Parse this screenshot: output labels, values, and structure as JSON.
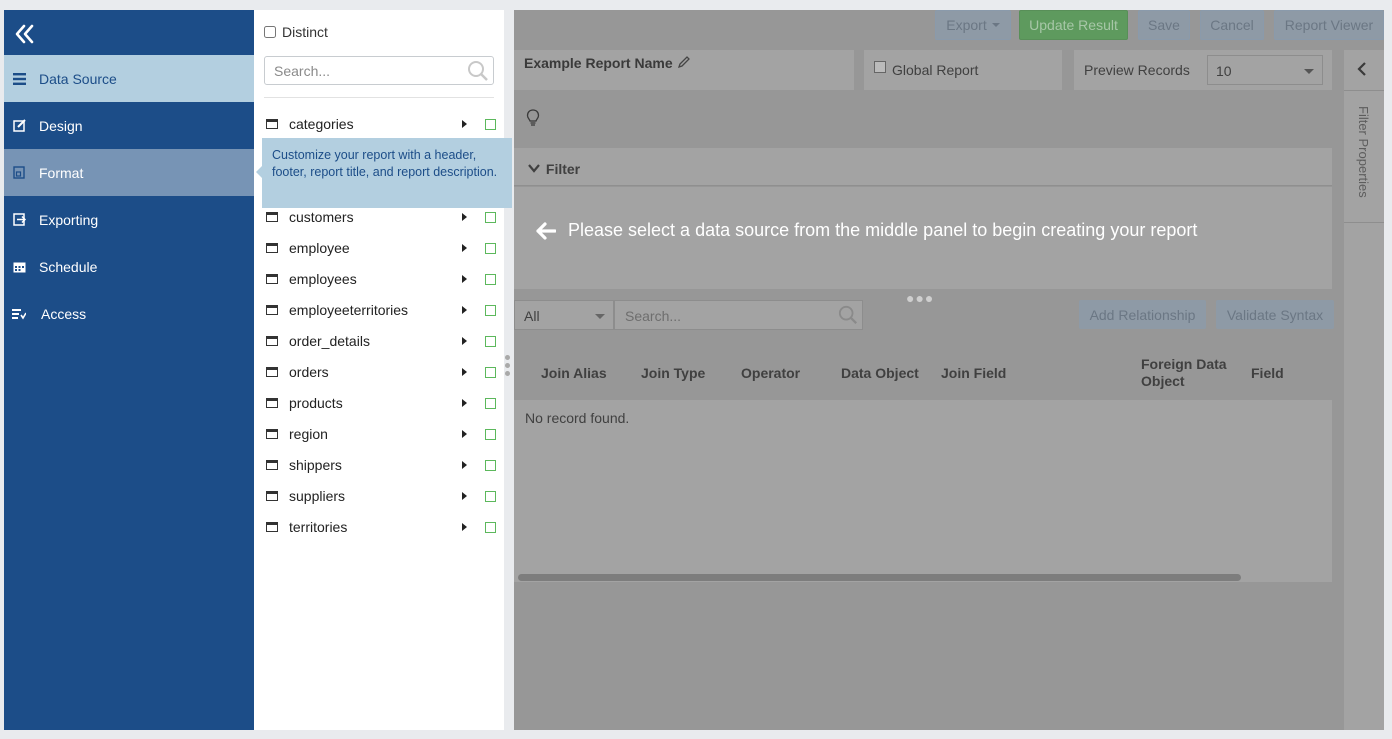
{
  "nav": {
    "items": [
      {
        "label": "Data Source",
        "icon": "list-icon"
      },
      {
        "label": "Design",
        "icon": "edit-icon"
      },
      {
        "label": "Format",
        "icon": "format-icon"
      },
      {
        "label": "Exporting",
        "icon": "export-icon"
      },
      {
        "label": "Schedule",
        "icon": "calendar-icon"
      },
      {
        "label": "Access",
        "icon": "access-icon"
      }
    ],
    "active_item": "Data Source",
    "hover_item": "Format"
  },
  "datasource": {
    "distinct_label": "Distinct",
    "search_placeholder": "Search...",
    "tables": [
      "categories",
      "customers",
      "employee",
      "employees",
      "employeeterritories",
      "order_details",
      "orders",
      "products",
      "region",
      "shippers",
      "suppliers",
      "territories"
    ]
  },
  "tooltip": {
    "text": "Customize your report with a header, footer, report title, and report description."
  },
  "toolbar": {
    "export_label": "Export",
    "update_label": "Update Result",
    "save_label": "Save",
    "cancel_label": "Cancel",
    "viewer_label": "Report Viewer"
  },
  "report": {
    "name": "Example Report Name",
    "global_label": "Global Report",
    "preview_label": "Preview Records",
    "preview_value": "10"
  },
  "filter": {
    "header": "Filter",
    "message": "Please select a data source from the middle panel to begin creating your report"
  },
  "relationships": {
    "filter_value": "All",
    "search_placeholder": "Search...",
    "add_label": "Add Relationship",
    "validate_label": "Validate Syntax",
    "columns": [
      "Join Alias",
      "Join Type",
      "Operator",
      "Data Object",
      "Join Field",
      "Foreign Data Object",
      "Field"
    ],
    "empty_text": "No record found."
  },
  "filter_properties": {
    "label": "Filter Properties"
  },
  "colors": {
    "nav_bg": "#1c4d88",
    "nav_active": "#b3cfe0",
    "nav_hover": "#7794b5",
    "overlay": "#979797",
    "checkbox_green": "#5cb85c"
  }
}
